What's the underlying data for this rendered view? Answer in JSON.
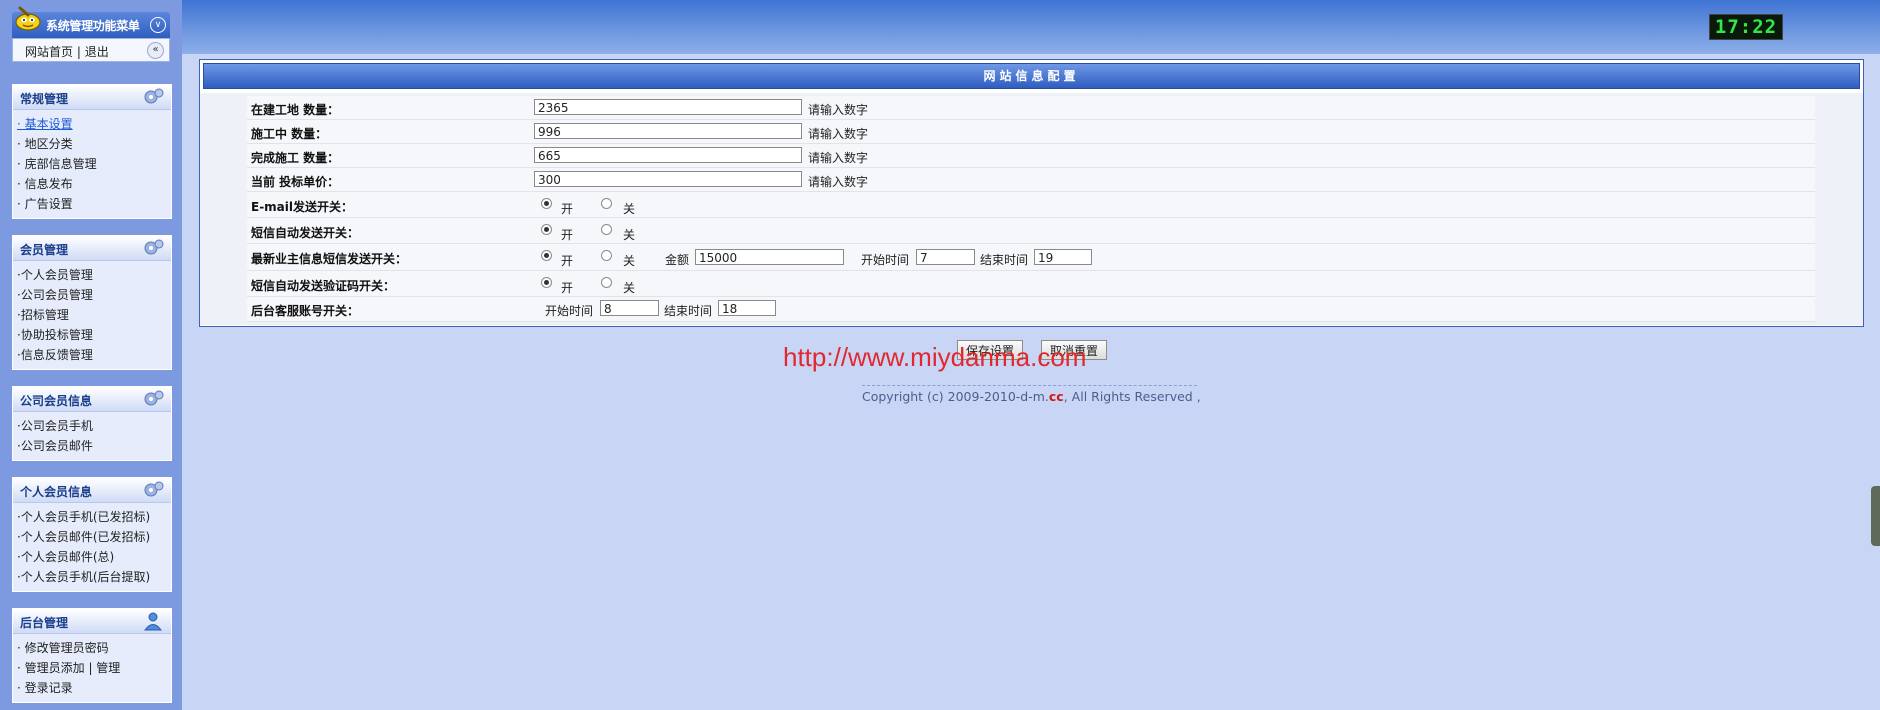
{
  "sidebar": {
    "title": "系统管理功能菜单",
    "home_link": "网站首页",
    "separator": " | ",
    "logout_link": "退出",
    "groups": [
      {
        "title": "常规管理",
        "items": [
          "· 基本设置",
          "· 地区分类",
          "· 庑部信息管理",
          "· 信息发布",
          "· 广告设置"
        ]
      },
      {
        "title": "会员管理",
        "items": [
          "·个人会员管理",
          "·公司会员管理",
          "·招标管理",
          "·协助投标管理",
          "·信息反馈管理"
        ]
      },
      {
        "title": "公司会员信息",
        "items": [
          "·公司会员手机",
          "·公司会员邮件"
        ]
      },
      {
        "title": "个人会员信息",
        "items": [
          "·个人会员手机(已发招标)",
          "·个人会员邮件(已发招标)",
          "·个人会员邮件(总)",
          "·个人会员手机(后台提取)"
        ]
      },
      {
        "title": "后台管理",
        "items": [
          "· 修改管理员密码",
          "· 管理员添加 | 管理",
          "· 登录记录"
        ]
      }
    ]
  },
  "clock": "17:22",
  "panel": {
    "title": "网站信息配置",
    "rows": {
      "building": {
        "label": "在建工地 数量：",
        "value": "2365",
        "hint": "请输入数字"
      },
      "working": {
        "label": "施工中 数量：",
        "value": "996",
        "hint": "请输入数字"
      },
      "finished": {
        "label": "完成施工 数量：",
        "value": "665",
        "hint": "请输入数字"
      },
      "price": {
        "label": "当前 投标单价：",
        "value": "300",
        "hint": "请输入数字"
      },
      "email_switch": {
        "label": "E-mail发送开关：",
        "on": "开",
        "off": "关"
      },
      "sms_switch": {
        "label": "短信自动发送开关：",
        "on": "开",
        "off": "关"
      },
      "owner_sms": {
        "label": "最新业主信息短信发送开关：",
        "on": "开",
        "off": "关",
        "amount_label": "金额",
        "amount": "15000",
        "start_label": "开始时间",
        "start": "7",
        "end_label": "结束时间",
        "end": "19"
      },
      "verify_sms": {
        "label": "短信自动发送验证码开关：",
        "on": "开",
        "off": "关"
      },
      "service": {
        "label": "后台客服账号开关：",
        "start_label": "开始时间",
        "start": "8",
        "end_label": "结束时间",
        "end": "18"
      }
    }
  },
  "buttons": {
    "save": "保存设置",
    "reset": "取消重置"
  },
  "watermark": "http://www.miydanma.com",
  "footer": {
    "prefix": "Copyright (c) 2009-2010-d-m.",
    "highlight": "cc",
    "suffix": ", All Rights Reserved ,"
  }
}
